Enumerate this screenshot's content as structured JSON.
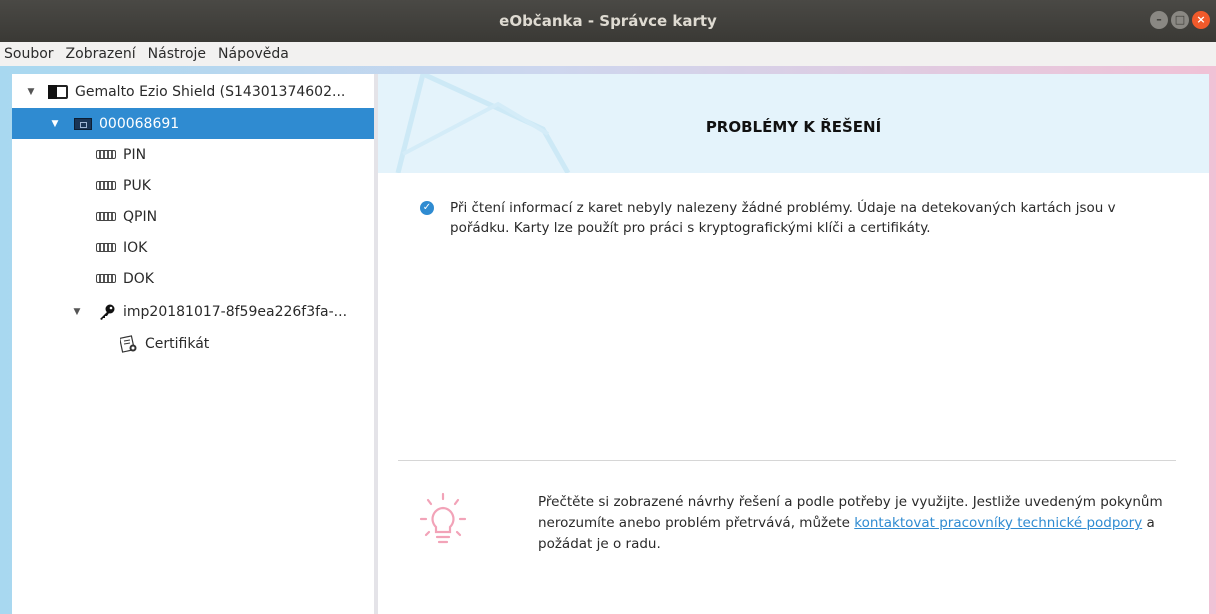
{
  "window": {
    "title": "eObčanka - Správce karty"
  },
  "menu": [
    "Soubor",
    "Zobrazení",
    "Nástroje",
    "Nápověda"
  ],
  "tree": {
    "reader": "Gemalto Ezio Shield (S14301374602...",
    "card": "000068691",
    "items": [
      "PIN",
      "PUK",
      "QPIN",
      "IOK",
      "DOK"
    ],
    "key": "imp20181017-8f59ea226f3fa-...",
    "certificate": "Certifikát"
  },
  "content": {
    "title": "PROBLÉMY K ŘEŠENÍ",
    "status": "Při čtení informací z karet nebyly nalezeny žádné problémy. Údaje na detekovaných kartách jsou v pořádku. Karty lze použít pro práci s kryptografickými klíči a certifikáty.",
    "help_before": "Přečtěte si zobrazené návrhy řešení a podle potřeby je využijte. Jestliže uvedeným pokynům nerozumíte anebo problém přetrvává, můžete ",
    "help_link": "kontaktovat pracovníky technické podpory",
    "help_after": " a požádat je o radu."
  }
}
